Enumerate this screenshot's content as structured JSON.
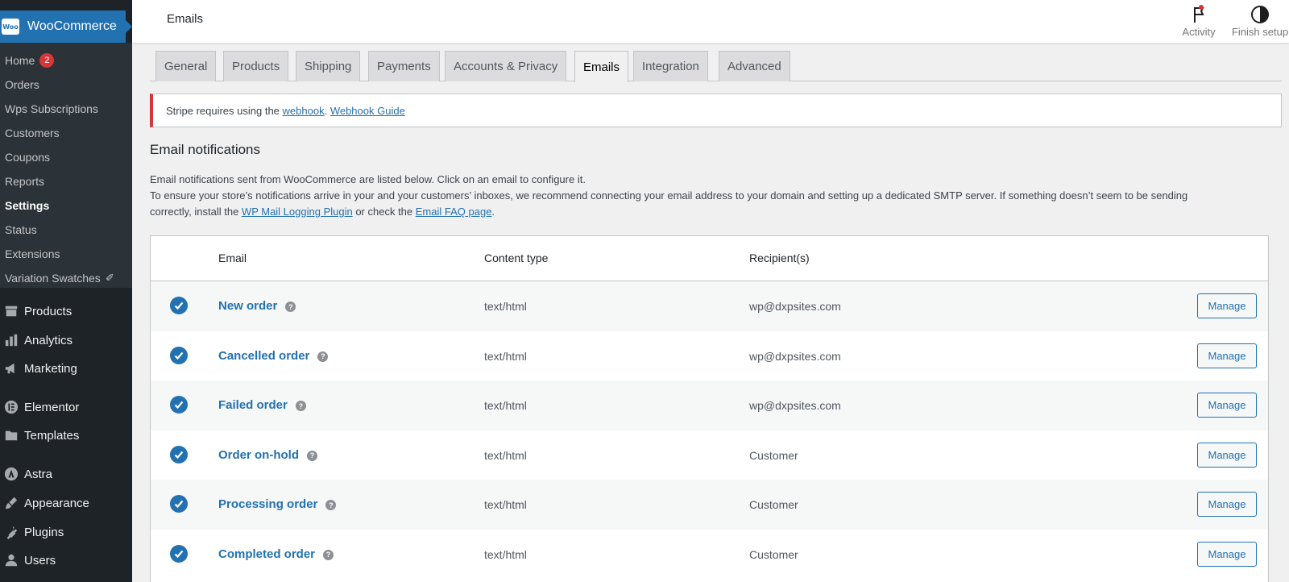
{
  "sidebar": {
    "brand": "WooCommerce",
    "logo_text": "Woo",
    "submenu": [
      {
        "label": "Home",
        "badge": "2"
      },
      {
        "label": "Orders"
      },
      {
        "label": "Wps Subscriptions"
      },
      {
        "label": "Customers"
      },
      {
        "label": "Coupons"
      },
      {
        "label": "Reports"
      },
      {
        "label": "Settings",
        "active": true
      },
      {
        "label": "Status"
      },
      {
        "label": "Extensions"
      },
      {
        "label": "Variation Swatches",
        "icon": "swatch-icon"
      }
    ],
    "menu": [
      {
        "label": "Products",
        "icon": "archive-icon"
      },
      {
        "label": "Analytics",
        "icon": "bar-chart-icon"
      },
      {
        "label": "Marketing",
        "icon": "megaphone-icon"
      },
      {
        "label": "Elementor",
        "icon": "elementor-icon"
      },
      {
        "label": "Templates",
        "icon": "folder-icon"
      },
      {
        "label": "Astra",
        "icon": "astra-icon"
      },
      {
        "label": "Appearance",
        "icon": "paintbrush-icon"
      },
      {
        "label": "Plugins",
        "icon": "plug-icon"
      },
      {
        "label": "Users",
        "icon": "user-icon"
      }
    ]
  },
  "topbar": {
    "title": "Emails",
    "activity_label": "Activity",
    "finish_setup_label": "Finish setup"
  },
  "tabs": [
    {
      "label": "General"
    },
    {
      "label": "Products"
    },
    {
      "label": "Shipping"
    },
    {
      "label": "Payments"
    },
    {
      "label": "Accounts & Privacy"
    },
    {
      "label": "Emails",
      "active": true
    },
    {
      "label": "Integration"
    },
    {
      "label": "Advanced"
    }
  ],
  "notice": {
    "prefix": "Stripe requires using the ",
    "link1": "webhook",
    "middle": ". ",
    "link2": "Webhook Guide"
  },
  "section": {
    "title": "Email notifications",
    "line1": "Email notifications sent from WooCommerce are listed below. Click on an email to configure it.",
    "line2": "To ensure your store’s notifications arrive in your and your customers’ inboxes, we recommend connecting your email address to your domain and setting up a dedicated SMTP server. If something doesn’t seem to be sending",
    "line3_prefix": "correctly, install the ",
    "line3_link1": "WP Mail Logging Plugin",
    "line3_middle": " or check the ",
    "line3_link2": "Email FAQ page",
    "line3_suffix": "."
  },
  "table": {
    "headers": {
      "email": "Email",
      "content_type": "Content type",
      "recipients": "Recipient(s)"
    },
    "manage_label": "Manage",
    "help_glyph": "?",
    "rows": [
      {
        "name": "New order",
        "content_type": "text/html",
        "recipient": "wp@dxpsites.com"
      },
      {
        "name": "Cancelled order",
        "content_type": "text/html",
        "recipient": "wp@dxpsites.com"
      },
      {
        "name": "Failed order",
        "content_type": "text/html",
        "recipient": "wp@dxpsites.com"
      },
      {
        "name": "Order on-hold",
        "content_type": "text/html",
        "recipient": "Customer"
      },
      {
        "name": "Processing order",
        "content_type": "text/html",
        "recipient": "Customer"
      },
      {
        "name": "Completed order",
        "content_type": "text/html",
        "recipient": "Customer"
      }
    ]
  },
  "colors": {
    "accent": "#2271b1",
    "sidebar_bg": "#1d2327",
    "submenu_bg": "#2c3338",
    "badge": "#d63638",
    "notice_border": "#d63638"
  }
}
